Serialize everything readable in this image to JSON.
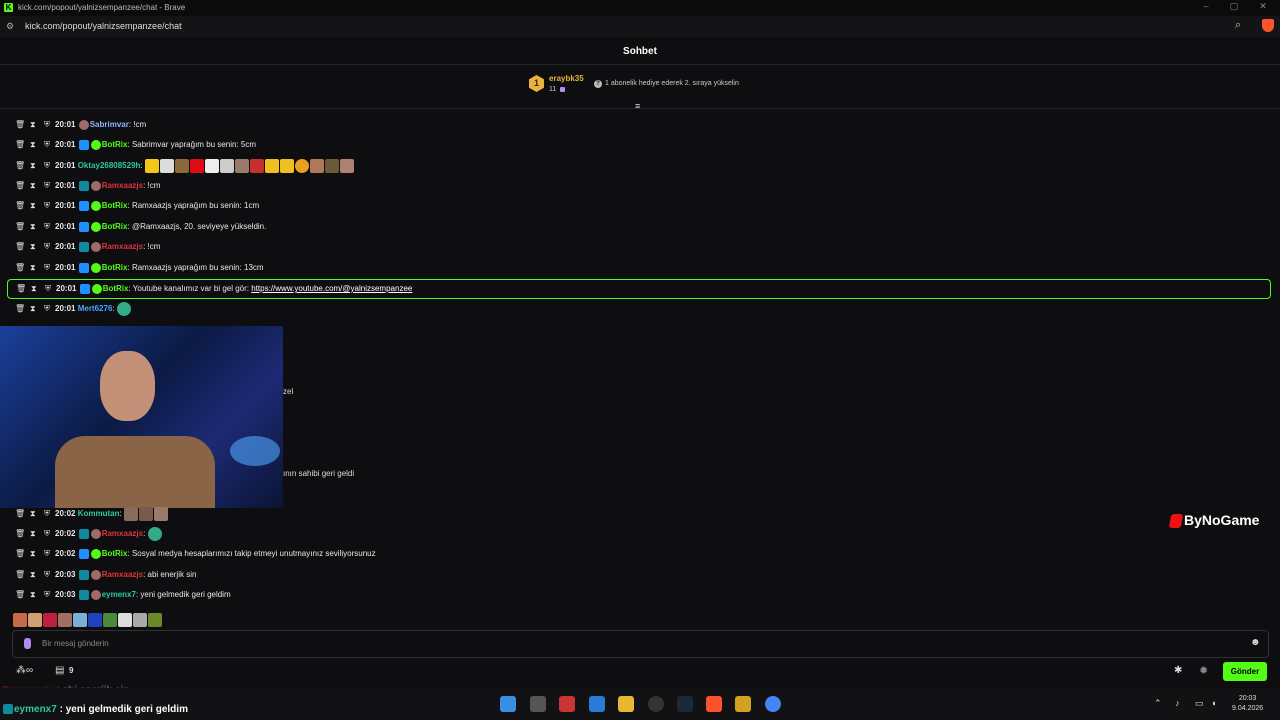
{
  "browser": {
    "window_title": "kick.com/popout/yalnizsempanzee/chat - Brave",
    "url": "kick.com/popout/yalnizsempanzee/chat",
    "favicon": "K"
  },
  "chat": {
    "title": "Sohbet",
    "pinned": {
      "rank": "1",
      "username": "eraybk35",
      "gift_count": "11",
      "promo_text": "1 abonelik hediye ederek 2. sıraya yükselin"
    },
    "messages": [
      {
        "time": "20:01",
        "user": "Sabrimvar",
        "sep": ":",
        "text": " !cm",
        "color": "#8fb3ff"
      },
      {
        "time": "20:01",
        "user": "BotRix",
        "sep": ":",
        "text": " Sabrimvar yaprağım bu senin: 5cm",
        "color": "#53fc18"
      },
      {
        "time": "20:01",
        "user": "Oktay26808529h",
        "sep": ":",
        "text": "",
        "color": "#2ec7a0"
      },
      {
        "time": "20:01",
        "user": "Ramxaazjs",
        "sep": ":",
        "text": " !cm",
        "color": "#e0333b"
      },
      {
        "time": "20:01",
        "user": "BotRix",
        "sep": ":",
        "text": " Ramxaazjs yaprağım bu senin: 1cm",
        "color": "#53fc18"
      },
      {
        "time": "20:01",
        "user": "BotRix",
        "sep": ":",
        "text": " @Ramxaazjs, 20. seviyeye yükseldin.",
        "color": "#53fc18"
      },
      {
        "time": "20:01",
        "user": "Ramxaazjs",
        "sep": ":",
        "text": " !cm",
        "color": "#e0333b"
      },
      {
        "time": "20:01",
        "user": "BotRix",
        "sep": ":",
        "text": " Ramxaazjs yaprağım bu senin: 13cm",
        "color": "#53fc18"
      },
      {
        "time": "20:01",
        "user": "BotRix",
        "sep": ":",
        "text": " Youtube kanalımız var bi gel gör: ",
        "link": "https://www.youtube.com/@yalnizsempanzee",
        "color": "#53fc18"
      },
      {
        "time": "20:01",
        "user": "Mert6276",
        "sep": ":",
        "text": "",
        "color": "#4aa3ff"
      },
      {
        "time": "20:02",
        "user": "Kommutan",
        "sep": ":",
        "text": "",
        "color": "#2ec7a0"
      },
      {
        "time": "20:02",
        "user": "Ramxaazjs",
        "sep": ":",
        "text": "",
        "color": "#e0333b"
      },
      {
        "time": "20:02",
        "user": "BotRix",
        "sep": ":",
        "text": " Sosyal medya hesaplarımızı takip etmeyi unutmayınız seviliyorsunuz",
        "color": "#53fc18"
      },
      {
        "time": "20:03",
        "user": "Ramxaazjs",
        "sep": ":",
        "text": " abi enerjik sin",
        "color": "#e0333b"
      },
      {
        "time": "20:03",
        "user": "eymenx7",
        "sep": ":",
        "text": " yeni gelmedik geri geldim",
        "color": "#2ec7a0"
      }
    ],
    "partial_texts": [
      "zel",
      "ının sahibi geri geldi"
    ],
    "input_placeholder": "Bir mesaj gönderin",
    "points_count": "9",
    "send_label": "Gönder"
  },
  "watermark": "ByNoGame",
  "overlay": [
    {
      "user": "Ramxaazjs",
      "text": " : abi enerjik sin",
      "color": "#e0333b"
    },
    {
      "user": "eymenx7",
      "text": " : yeni gelmedik geri geldim",
      "color": "#2ec7a0"
    }
  ],
  "taskbar": {
    "time": "20:03",
    "date": "9.04.2026"
  },
  "colors": {
    "accent": "#53fc18",
    "background": "#0e0e10"
  }
}
